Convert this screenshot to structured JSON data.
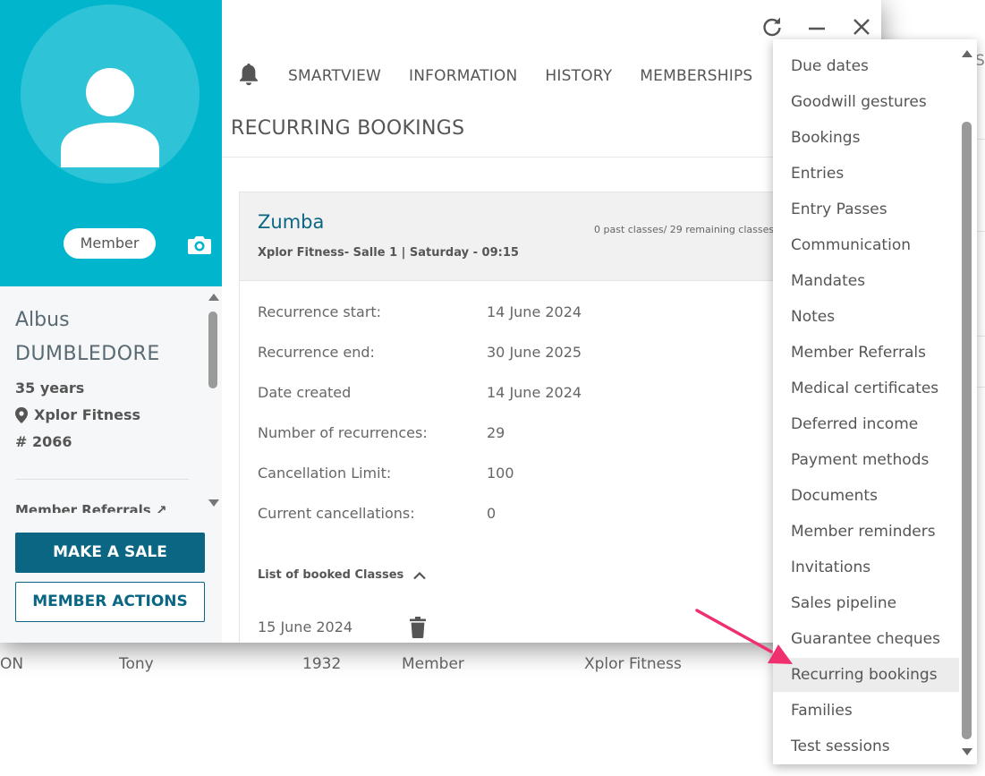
{
  "background": {
    "row": {
      "c1": "ON",
      "c2": "Tony",
      "c3": "1932",
      "c4": "Member",
      "c5": "Xplor Fitness"
    },
    "right_edge_text": "S"
  },
  "sidebar": {
    "badge": "Member",
    "first_name": "Albus",
    "last_name": "DUMBLEDORE",
    "age": "35 years",
    "club": "Xplor Fitness",
    "member_number": "# 2066",
    "referrals_link": "Member Referrals",
    "make_sale": "MAKE A SALE",
    "member_actions": "MEMBER ACTIONS"
  },
  "tabs": [
    "SMARTVIEW",
    "INFORMATION",
    "HISTORY",
    "MEMBERSHIPS"
  ],
  "section_title": "RECURRING BOOKINGS",
  "booking": {
    "class_name": "Zumba",
    "subtitle": "Xplor Fitness- Salle 1 | Saturday - 09:15",
    "count": "0 past classes/ 29 remaining classes",
    "details": [
      {
        "label": "Recurrence start:",
        "value": "14 June 2024"
      },
      {
        "label": "Recurrence end:",
        "value": "30 June 2025"
      },
      {
        "label": "Date created",
        "value": "14 June 2024"
      },
      {
        "label": "Number of recurrences:",
        "value": "29"
      },
      {
        "label": "Cancellation Limit:",
        "value": "100"
      },
      {
        "label": "Current cancellations:",
        "value": "0"
      }
    ],
    "booked_list_label": "List of booked Classes",
    "booked_items": [
      "15 June 2024"
    ]
  },
  "menu": {
    "items": [
      "Due dates",
      "Goodwill gestures",
      "Bookings",
      "Entries",
      "Entry Passes",
      "Communication",
      "Mandates",
      "Notes",
      "Member Referrals",
      "Medical certificates",
      "Deferred income",
      "Payment methods",
      "Documents",
      "Member reminders",
      "Invitations",
      "Sales pipeline",
      "Guarantee cheques",
      "Recurring bookings",
      "Families",
      "Test sessions"
    ],
    "active": "Recurring bookings"
  },
  "colors": {
    "brand": "#00b5cc",
    "primary": "#0b6683",
    "annotation_arrow": "#f0306e"
  }
}
